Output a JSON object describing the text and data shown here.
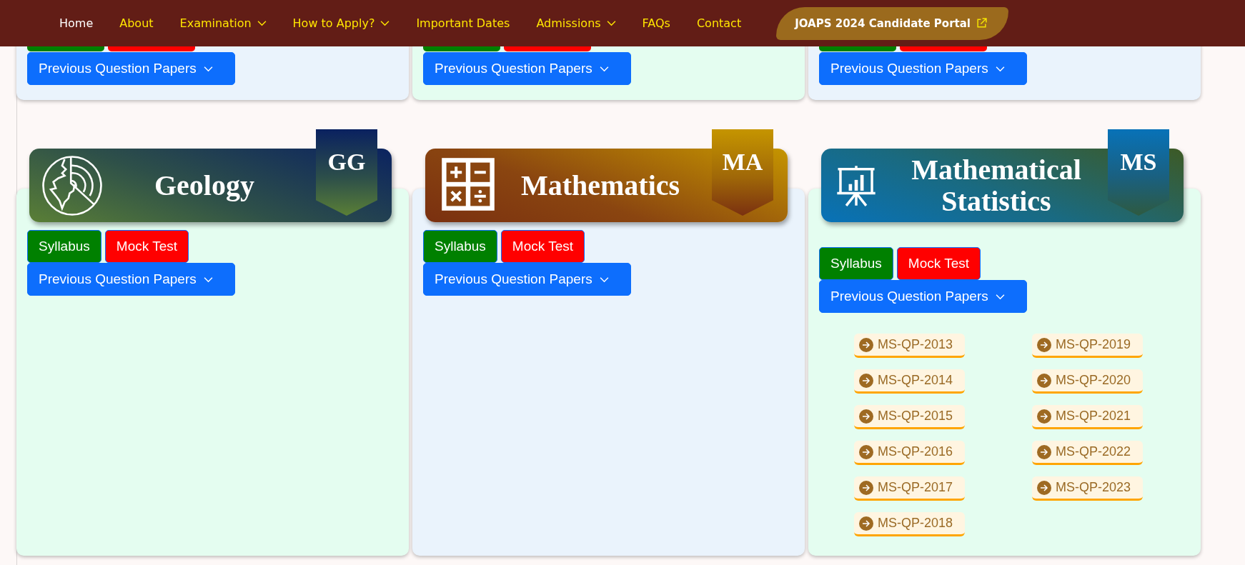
{
  "nav": {
    "items": [
      {
        "label": "Home",
        "selected": true,
        "has_menu": false
      },
      {
        "label": "About",
        "selected": false,
        "has_menu": false
      },
      {
        "label": "Examination",
        "selected": false,
        "has_menu": true
      },
      {
        "label": "How to Apply?",
        "selected": false,
        "has_menu": true
      },
      {
        "label": "Important Dates",
        "selected": false,
        "has_menu": false
      },
      {
        "label": "Admissions",
        "selected": false,
        "has_menu": true
      },
      {
        "label": "FAQs",
        "selected": false,
        "has_menu": false
      },
      {
        "label": "Contact",
        "selected": false,
        "has_menu": false
      }
    ],
    "portal": {
      "label": "JOAPS 2024 Candidate Portal"
    }
  },
  "top_cards": [
    {
      "color": "#eaf3fc",
      "papers_button": "Previous Question Papers"
    },
    {
      "color": "#e4fdf0",
      "papers_button": "Previous Question Papers"
    },
    {
      "color": "#eaf3fc",
      "papers_button": "Previous Question Papers"
    }
  ],
  "subjects": [
    {
      "kind": "geology",
      "title": "Geology",
      "code": "GG",
      "color": "#e4fdf0",
      "syllabus": "Syllabus",
      "mock_test": "Mock Test",
      "papers_button": "Previous Question Papers"
    },
    {
      "kind": "mathematics",
      "title": "Mathematics",
      "code": "MA",
      "color": "#eaf3fc",
      "syllabus": "Syllabus",
      "mock_test": "Mock Test",
      "papers_button": "Previous Question Papers"
    },
    {
      "kind": "statistics",
      "title": "Mathematical Statistics",
      "code": "MS",
      "color": "#e4fdf0",
      "syllabus": "Syllabus",
      "mock_test": "Mock Test",
      "papers_button": "Previous Question Papers",
      "papers": [
        "MS-QP-2013",
        "MS-QP-2014",
        "MS-QP-2015",
        "MS-QP-2016",
        "MS-QP-2017",
        "MS-QP-2018",
        "MS-QP-2019",
        "MS-QP-2020",
        "MS-QP-2021",
        "MS-QP-2022",
        "MS-QP-2023"
      ]
    }
  ]
}
